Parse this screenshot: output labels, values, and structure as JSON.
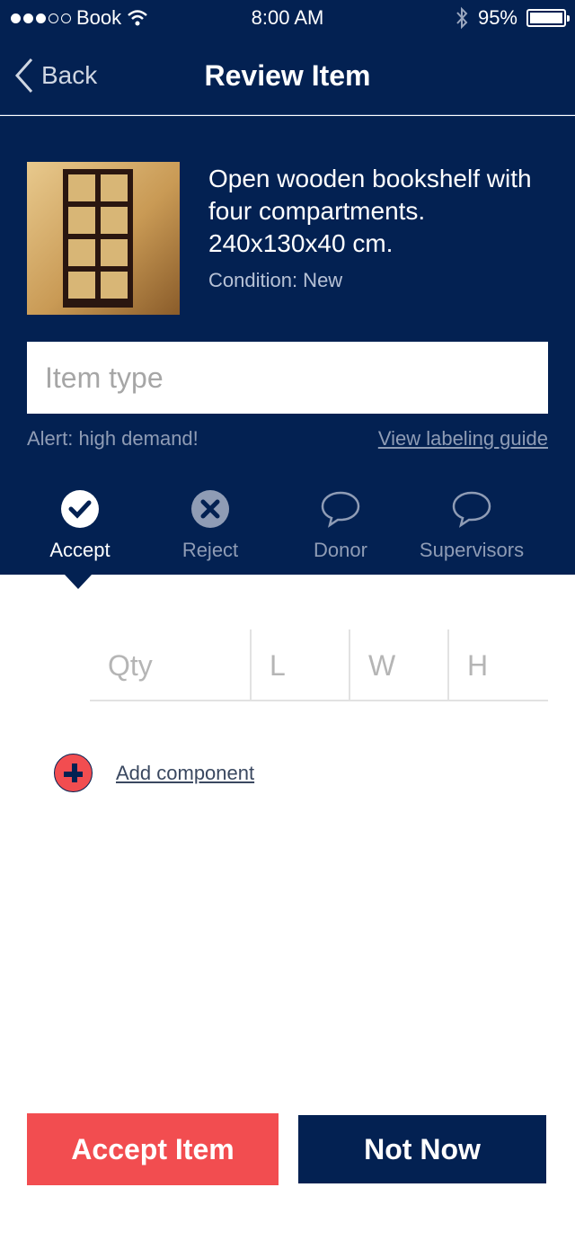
{
  "status_bar": {
    "carrier": "Book",
    "time": "8:00 AM",
    "battery": "95%"
  },
  "nav": {
    "back_label": "Back",
    "title": "Review Item"
  },
  "item": {
    "description": "Open wooden bookshelf with four compartments. 240x130x40 cm.",
    "condition": "Condition: New"
  },
  "item_type": {
    "placeholder": "Item type",
    "value": ""
  },
  "alert": "Alert: high demand!",
  "guide_link": "View labeling guide",
  "tabs": [
    {
      "label": "Accept",
      "icon": "checkmark-circle-icon",
      "active": true
    },
    {
      "label": "Reject",
      "icon": "x-circle-icon",
      "active": false
    },
    {
      "label": "Donor",
      "icon": "speech-bubble-icon",
      "active": false
    },
    {
      "label": "Supervisors",
      "icon": "speech-bubble-icon",
      "active": false
    }
  ],
  "dimensions": {
    "qty": "Qty",
    "l": "L",
    "w": "W",
    "h": "H"
  },
  "add_component_label": "Add component",
  "buttons": {
    "accept": "Accept Item",
    "not_now": "Not Now"
  },
  "colors": {
    "navy": "#032152",
    "accent_red": "#F24D50",
    "muted_text": "#8F9CB5"
  }
}
